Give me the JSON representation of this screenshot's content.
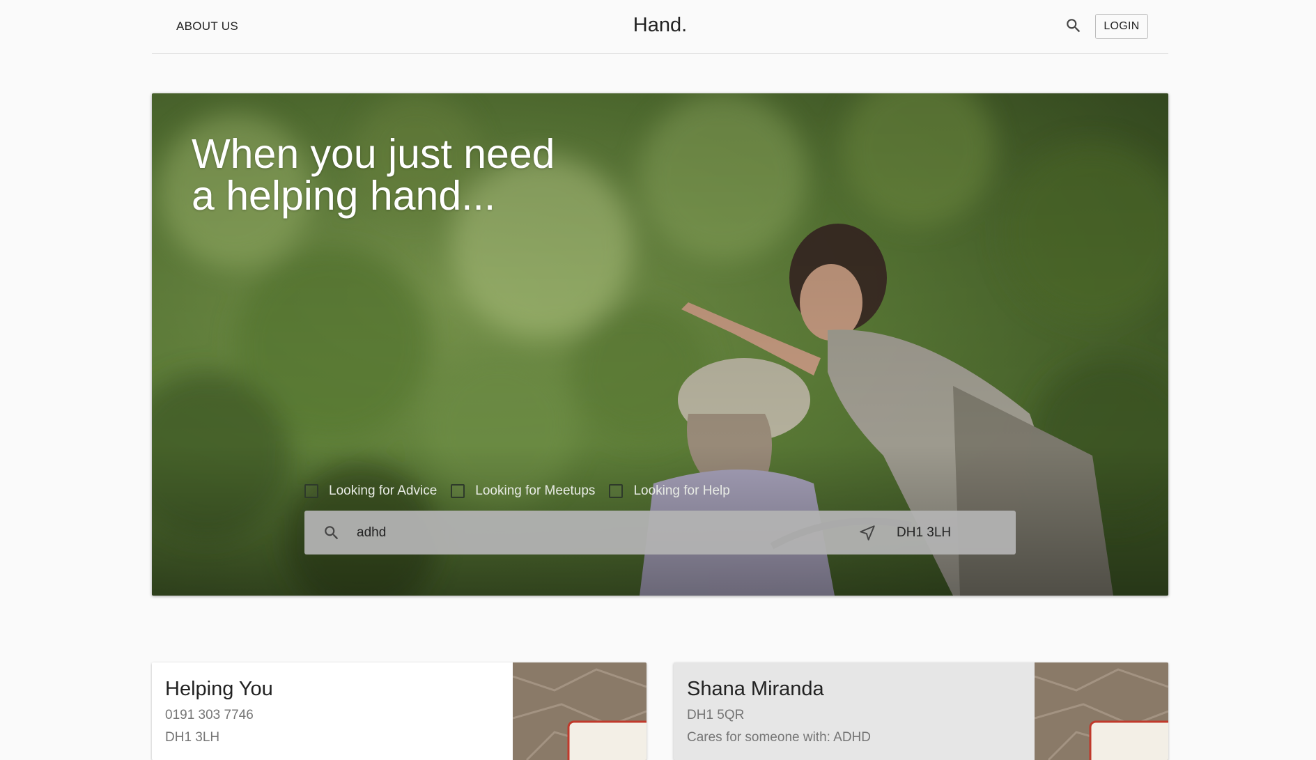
{
  "header": {
    "nav_about": "ABOUT US",
    "brand": "Hand.",
    "search_icon": "search-icon",
    "login_label": "LOGIN"
  },
  "hero": {
    "title_line1": "When you just need",
    "title_line2": "a helping hand...",
    "filters": [
      {
        "label": "Looking for Advice",
        "checked": false
      },
      {
        "label": "Looking for Meetups",
        "checked": false
      },
      {
        "label": "Looking for Help",
        "checked": false
      }
    ],
    "search": {
      "query": "adhd",
      "location": "DH1 3LH",
      "search_icon": "search-icon",
      "location_icon": "navigation-arrow-icon"
    }
  },
  "results": [
    {
      "title": "Helping You",
      "line1": "0191 303 7746",
      "line2": "DH1 3LH"
    },
    {
      "title": "Shana Miranda",
      "line1": "DH1 5QR",
      "line2": "Cares for someone with: ADHD"
    }
  ],
  "colors": {
    "page_bg": "#fafafa",
    "card_alt_bg": "#e6e6e6",
    "search_bar_bg": "#b2b2b2",
    "text_primary": "#222222",
    "text_secondary": "#757575"
  }
}
